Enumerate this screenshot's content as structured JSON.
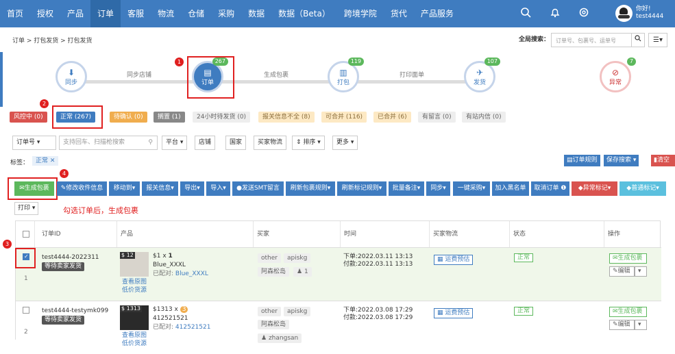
{
  "nav": {
    "items": [
      "首页",
      "授权",
      "产品",
      "订单",
      "客服",
      "物流",
      "仓储",
      "采购",
      "数据",
      "数据（Beta）",
      "跨境学院",
      "货代",
      "产品服务"
    ],
    "active_index": 3,
    "greeting": "你好!",
    "username": "test4444"
  },
  "crumb": "订单 > 打包发货 > 打包发货",
  "global_search": {
    "label": "全局搜索：",
    "placeholder": "订单号、包裹号、运单号"
  },
  "flow": {
    "steps": [
      {
        "label": "同步",
        "icon": "download-icon"
      },
      {
        "label": "订单",
        "badge": "267",
        "icon": "card-icon"
      },
      {
        "label": "打包",
        "badge": "119",
        "icon": "barcode-icon"
      },
      {
        "label": "发货",
        "badge": "107",
        "icon": "plane-icon"
      },
      {
        "label": "异常",
        "badge": "7",
        "icon": "eye-off-icon"
      }
    ],
    "links": [
      "同步店铺",
      "生成包裹",
      "打印面单"
    ]
  },
  "tabs": [
    "风控中 (0)",
    "正常 (267)",
    "待确认 (0)",
    "搁置 (1)",
    "24小时待发货 (0)",
    "报关信息不全 (8)",
    "可合并 (116)",
    "已合并 (6)",
    "有留言 (0)",
    "有站内信 (0)"
  ],
  "filters": {
    "order_no": "订单号",
    "search_placeholder": "支持回车、扫描枪搜索",
    "platform": "平台",
    "store": "店铺",
    "country": "国家",
    "logistics": "买家物流",
    "sort": "排序",
    "more": "更多"
  },
  "tag": {
    "label": "标签：",
    "value": "正常"
  },
  "right_buttons": [
    "订单规则",
    "保存搜索",
    "清空"
  ],
  "toolbar": [
    "生成包裹",
    "修改收件信息",
    "移动到",
    "报关信息",
    "导出",
    "导入",
    "发送SMT留言",
    "刷新包裹规则",
    "刷新标记规则",
    "批量备注",
    "同步",
    "一键采购",
    "加入黑名单",
    "取消订单",
    "异常标记",
    "普通标记"
  ],
  "print": "打印",
  "hint": "勾选订单后，生成包裹",
  "annotations": [
    "1",
    "2",
    "3",
    "4"
  ],
  "table": {
    "headers": [
      "订单ID",
      "产品",
      "买家",
      "时间",
      "买家物流",
      "状态",
      "操作"
    ],
    "rows": [
      {
        "index": "1",
        "id": "test4444-2022311",
        "status_pill": "等待卖家发货",
        "qty_tag": "$ 12",
        "price": "$1 x",
        "qty": "1",
        "sku": "Blue_XXXL",
        "matched_label": "已配对:",
        "matched": "Blue_XXXL",
        "link1": "查看原图",
        "link2": "低价货源",
        "buyer": [
          "other",
          "apiskg",
          "阿森松岛",
          "1"
        ],
        "order_time": "下单:2022.03.11 13:13",
        "pay_time": "付款:2022.03.11 13:13",
        "logistics": "运费预估",
        "state": "正常",
        "op1": "生成包裹",
        "op2": "编辑"
      },
      {
        "index": "2",
        "id": "test4444-testymk099",
        "status_pill": "等待卖家发货",
        "qty_tag": "$ 1313",
        "price": "$1313 x",
        "qty": "3",
        "sku": "412521521",
        "matched_label": "已配对:",
        "matched": "412521521",
        "link1": "查看原图",
        "link2": "低价货源",
        "buyer": [
          "other",
          "apiskg",
          "阿森松岛",
          "zhangsan"
        ],
        "order_time": "下单:2022.03.08 17:29",
        "pay_time": "付款:2022.03.08 17:29",
        "logistics": "运费预估",
        "state": "正常",
        "op1": "生成包裹",
        "op2": "编辑"
      }
    ]
  }
}
